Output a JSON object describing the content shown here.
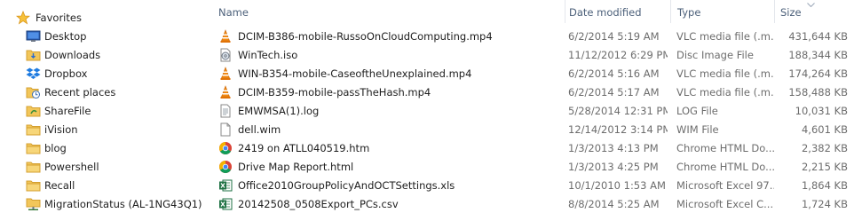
{
  "nav": {
    "group_label": "Favorites",
    "items": [
      {
        "label": "Desktop",
        "icon": "desktop-icon"
      },
      {
        "label": "Downloads",
        "icon": "downloads-folder-icon"
      },
      {
        "label": "Dropbox",
        "icon": "dropbox-icon"
      },
      {
        "label": "Recent places",
        "icon": "recent-places-icon"
      },
      {
        "label": "ShareFile",
        "icon": "sharefile-folder-icon"
      },
      {
        "label": "iVision",
        "icon": "folder-icon"
      },
      {
        "label": "blog",
        "icon": "folder-icon"
      },
      {
        "label": "Powershell",
        "icon": "folder-icon"
      },
      {
        "label": "Recall",
        "icon": "folder-icon"
      },
      {
        "label": "MigrationStatus (AL-1NG43Q1)",
        "icon": "network-folder-icon"
      }
    ]
  },
  "columns": {
    "name": "Name",
    "date": "Date modified",
    "type": "Type",
    "size": "Size"
  },
  "files": [
    {
      "name": "DCIM-B386-mobile-RussoOnCloudComputing.mp4",
      "date": "6/2/2014 5:19 AM",
      "type": "VLC media file (.m...",
      "size": "431,644 KB",
      "icon": "vlc-icon"
    },
    {
      "name": "WinTech.iso",
      "date": "11/12/2012 6:29 PM",
      "type": "Disc Image File",
      "size": "188,344 KB",
      "icon": "disc-image-icon"
    },
    {
      "name": "WIN-B354-mobile-CaseoftheUnexplained.mp4",
      "date": "6/2/2014 5:16 AM",
      "type": "VLC media file (.m...",
      "size": "174,264 KB",
      "icon": "vlc-icon"
    },
    {
      "name": "DCIM-B359-mobile-passTheHash.mp4",
      "date": "6/2/2014 5:17 AM",
      "type": "VLC media file (.m...",
      "size": "158,488 KB",
      "icon": "vlc-icon"
    },
    {
      "name": "EMWMSA(1).log",
      "date": "5/28/2014 12:31 PM",
      "type": "LOG File",
      "size": "10,031 KB",
      "icon": "text-file-icon"
    },
    {
      "name": "dell.wim",
      "date": "12/14/2012 3:14 PM",
      "type": "WIM File",
      "size": "4,601 KB",
      "icon": "blank-file-icon"
    },
    {
      "name": "2419 on ATLL040519.htm",
      "date": "1/3/2013 4:13 PM",
      "type": "Chrome HTML Do...",
      "size": "2,382 KB",
      "icon": "chrome-icon"
    },
    {
      "name": "Drive Map Report.html",
      "date": "1/3/2013 4:25 PM",
      "type": "Chrome HTML Do...",
      "size": "2,215 KB",
      "icon": "chrome-icon"
    },
    {
      "name": "Office2010GroupPolicyAndOCTSettings.xls",
      "date": "10/1/2010 1:53 AM",
      "type": "Microsoft Excel 97...",
      "size": "1,864 KB",
      "icon": "excel-icon"
    },
    {
      "name": "20142508_0508Export_PCs.csv",
      "date": "8/8/2014 5:25 AM",
      "type": "Microsoft Excel C...",
      "size": "1,724 KB",
      "icon": "excel-csv-icon"
    }
  ]
}
